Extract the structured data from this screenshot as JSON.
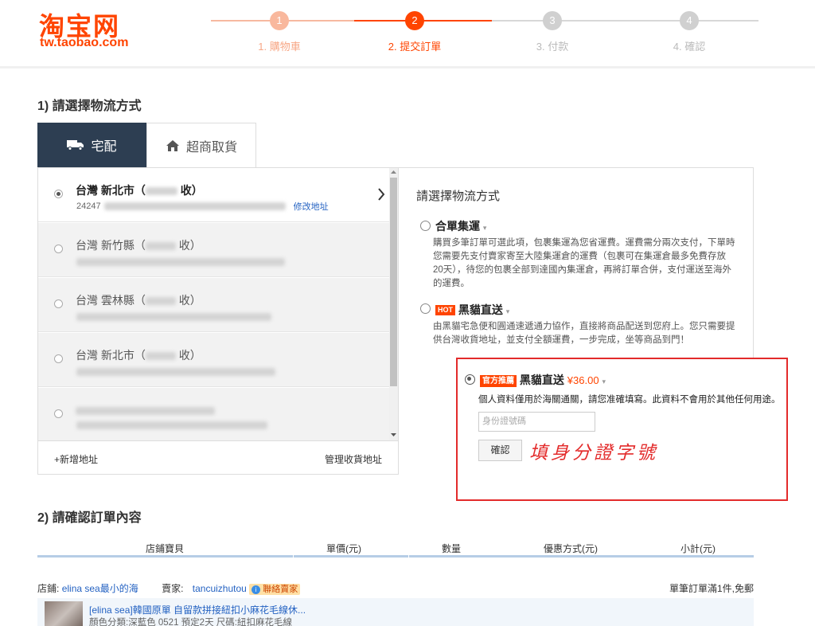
{
  "header": {
    "logo_cn": "淘宝网",
    "logo_url": "tw.taobao.com",
    "steps": [
      {
        "num": "1",
        "label": "1. 購物車"
      },
      {
        "num": "2",
        "label": "2. 提交訂單"
      },
      {
        "num": "3",
        "label": "3. 付款"
      },
      {
        "num": "4",
        "label": "4. 確認"
      }
    ],
    "active_step": 2
  },
  "shipping": {
    "title": "1) 請選擇物流方式",
    "tabs": [
      "宅配",
      "超商取貨"
    ],
    "addresses": [
      {
        "city": "台灣 新北市（",
        "suffix": "收）",
        "line2_prefix": "24247",
        "edit_link": "修改地址",
        "selected": true
      },
      {
        "city": "台灣 新竹縣（",
        "suffix": "收）",
        "selected": false
      },
      {
        "city": "台灣 雲林縣（",
        "suffix": "收）",
        "selected": false
      },
      {
        "city": "台灣 新北市（",
        "suffix": "收）",
        "selected": false
      }
    ],
    "add_address": "+新增地址",
    "manage_address": "管理收貨地址"
  },
  "logistics": {
    "title": "請選擇物流方式",
    "options": [
      {
        "name": "合單集運",
        "desc": "購買多筆訂單可選此項，包裹集運為您省運費。運費需分兩次支付，下單時您需要先支付賣家寄至大陸集運倉的運費（包裹可在集運倉最多免費存放20天），待您的包裹全部到達國內集運倉，再將訂單合併，支付運送至海外的運費。"
      },
      {
        "badge": "HOT",
        "name": "黑貓直送",
        "desc": "由黑貓宅急便和圓通速遞通力協作，直接將商品配送到您府上。您只需要提供台灣收貨地址，並支付全額運費，一步完成，坐等商品到門！"
      }
    ],
    "selected_option": {
      "badge": "官方推薦",
      "name": "黑貓直送",
      "price": "¥36.00",
      "notice": "個人資料僅用於海關通關，請您准確填寫。此資料不會用於其他任何用途。",
      "id_placeholder": "身份證號碼",
      "confirm": "確認",
      "handnote": "填身分證字號"
    }
  },
  "order": {
    "title": "2) 請確認訂單內容",
    "columns": [
      "店鋪寶貝",
      "單價(元)",
      "數量",
      "優惠方式(元)",
      "小計(元)"
    ],
    "shop_label": "店鋪:",
    "shop_name": "elina sea最小的海",
    "seller_label": "賣家:",
    "seller_name": "tancuizhutou",
    "seller_badge": "聯絡賣家",
    "shipping_note": "單筆訂單滿1件,免郵",
    "item_title": "[elina sea]韓國原單 自留款拼接紐扣小麻花毛線休...",
    "item_spec": "顏色分類:深藍色 0521 預定2天 尺碼:紐扣麻花毛線"
  }
}
